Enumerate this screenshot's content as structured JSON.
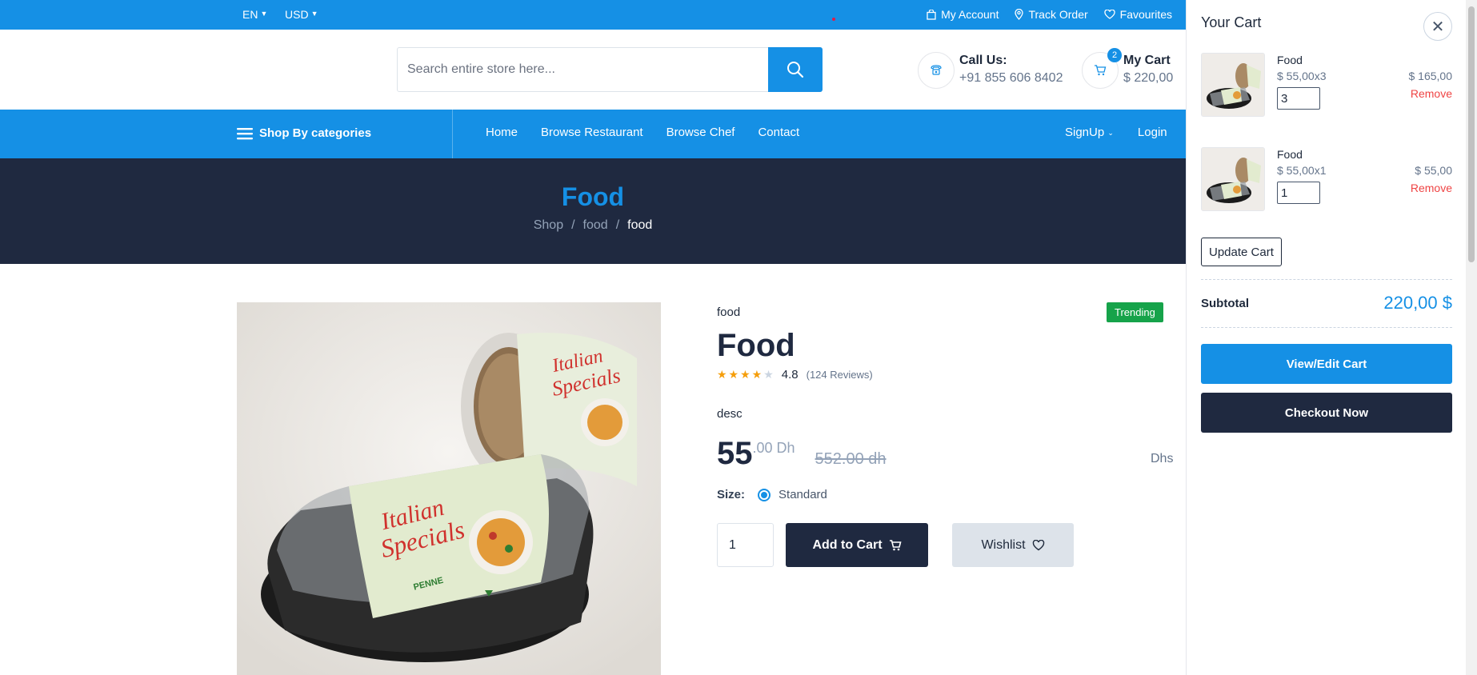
{
  "topbar": {
    "language": "EN",
    "currency": "USD",
    "links": {
      "account": "My Account",
      "track": "Track Order",
      "favourites": "Favourites"
    }
  },
  "header": {
    "search_placeholder": "Search entire store here...",
    "call_label": "Call Us:",
    "call_number": "+91 855 606 8402",
    "cart_label": "My Cart",
    "cart_total": "$ 220,00",
    "cart_count": "2"
  },
  "nav": {
    "categories_label": "Shop By categories",
    "links": [
      "Home",
      "Browse Restaurant",
      "Browse Chef",
      "Contact"
    ],
    "signup": "SignUp",
    "login": "Login"
  },
  "banner": {
    "title": "Food",
    "breadcrumb": [
      "Shop",
      "/",
      "food",
      "/",
      "food"
    ]
  },
  "product": {
    "category": "food",
    "badge": "Trending",
    "title": "Food",
    "rating": "4.8",
    "stars_filled": 4,
    "stars_total": 5,
    "reviews": "(124 Reviews)",
    "description": "desc",
    "price_main": "55",
    "price_decimal": ".00 Dh",
    "price_old": "552.00 dh",
    "currency_note": "Dhs",
    "size_label": "Size:",
    "size_option": "Standard",
    "quantity": "1",
    "add_to_cart": "Add to Cart",
    "wishlist": "Wishlist"
  },
  "cart_panel": {
    "title": "Your Cart",
    "items": [
      {
        "name": "Food",
        "price_qty": "$ 55,00x3",
        "qty": "3",
        "total": "$ 165,00",
        "remove": "Remove"
      },
      {
        "name": "Food",
        "price_qty": "$ 55,00x1",
        "qty": "1",
        "total": "$ 55,00",
        "remove": "Remove"
      }
    ],
    "update_label": "Update Cart",
    "subtotal_label": "Subtotal",
    "subtotal_value": "220,00 $",
    "view_edit": "View/Edit Cart",
    "checkout": "Checkout Now"
  },
  "colors": {
    "primary": "#1590e5",
    "dark": "#1f2940",
    "trending": "#16a34a",
    "remove": "#ef4444"
  }
}
